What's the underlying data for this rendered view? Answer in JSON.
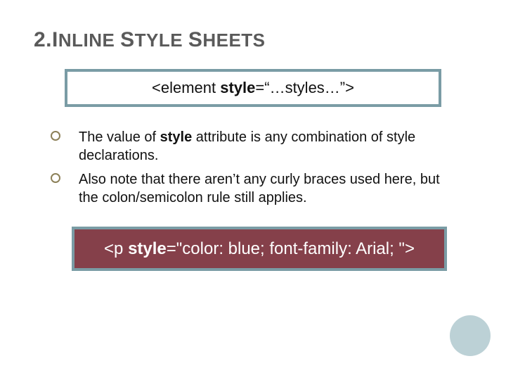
{
  "title": {
    "num": "2.",
    "cap1": "I",
    "rest1": "NLINE",
    "cap2": "S",
    "rest2": "TYLE",
    "cap3": "S",
    "rest3": "HEETS"
  },
  "syntax": {
    "prefix": "<element ",
    "attr": "style",
    "suffix": "=“…styles…”>"
  },
  "bullets": [
    {
      "pre": "The value of ",
      "bold": "style",
      "post": " attribute is any combination of style declarations."
    },
    {
      "pre": "Also note that there aren’t any curly braces used here, but the colon/semicolon rule still applies.",
      "bold": "",
      "post": ""
    }
  ],
  "example": {
    "prefix": "<p ",
    "attr": "style",
    "value": "=\"color: blue; font-family: Arial; \">"
  }
}
